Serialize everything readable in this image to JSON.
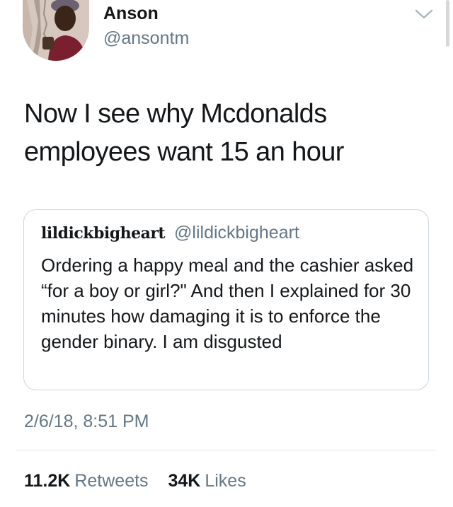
{
  "author": {
    "display_name": "Anson",
    "handle": "@ansontm"
  },
  "tweet": {
    "text": "Now I see why Mcdonalds employees want 15 an hour",
    "timestamp": "2/6/18, 8:51 PM"
  },
  "quoted_tweet": {
    "display_name": "lildickbigheart",
    "handle": "@lildickbigheart",
    "text": "Ordering a happy meal and the cashier asked “for a boy or girl?\" And then I explained for 30 minutes how damaging it is to enforce the gender binary. I am disgusted"
  },
  "stats": {
    "retweets_count": "11.2K",
    "retweets_label": "Retweets",
    "likes_count": "34K",
    "likes_label": "Likes"
  },
  "colors": {
    "primary_text": "#14171a",
    "secondary_text": "#657786",
    "border": "#ccd6dd"
  },
  "icons": {
    "menu": "chevron-down-icon"
  }
}
